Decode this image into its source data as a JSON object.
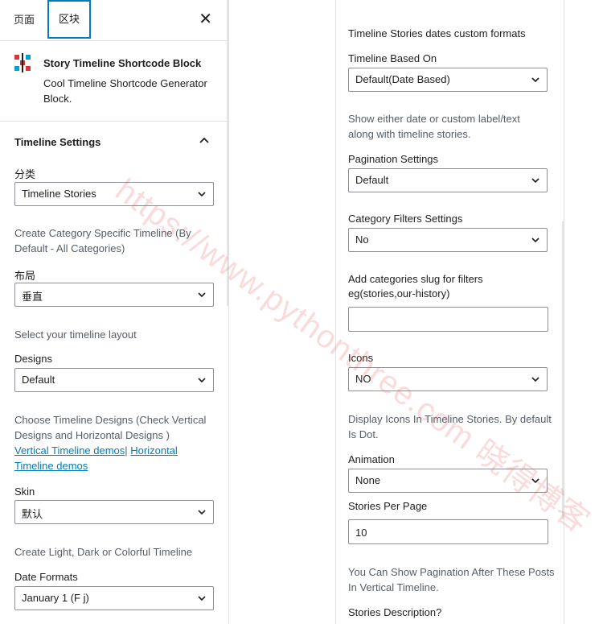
{
  "tabs": {
    "page": "页面",
    "block": "区块"
  },
  "block_card": {
    "title": "Story Timeline Shortcode Block",
    "description": "Cool Timeline Shortcode Generator Block."
  },
  "panel_title": "Timeline Settings",
  "left": {
    "category_label": "分类",
    "category_value": "Timeline Stories",
    "category_help": "Create Category Specific Timeline (By Default - All Categories)",
    "layout_label": "布局",
    "layout_value": "垂直",
    "layout_help": "Select your timeline layout",
    "designs_label": "Designs",
    "designs_value": "Default",
    "designs_help": "Choose Timeline Designs (Check Vertical Designs and Horizontal Designs )",
    "vertical_demo_link": "Vertical Timeline demos",
    "separator": "|",
    "horizontal_demo_link": "Horizontal Timeline demos",
    "skin_label": "Skin",
    "skin_value": "默认",
    "skin_help": "Create Light, Dark or Colorful Timeline",
    "date_formats_label": "Date Formats",
    "date_formats_value": "January 1 (F j)"
  },
  "right": {
    "dates_help": "Timeline Stories dates custom formats",
    "based_on_label": "Timeline Based On",
    "based_on_value": "Default(Date Based)",
    "based_on_help": "Show either date or custom label/text along with timeline stories.",
    "pagination_label": "Pagination Settings",
    "pagination_value": "Default",
    "category_filters_label": "Category Filters Settings",
    "category_filters_value": "No",
    "slug_label": "Add categories slug for filters eg(stories,our-history)",
    "slug_value": "",
    "icons_label": "Icons",
    "icons_value": "NO",
    "icons_help": "Display Icons In Timeline Stories. By default Is Dot.",
    "animation_label": "Animation",
    "animation_value": "None",
    "stories_per_page_label": "Stories Per Page",
    "stories_per_page_value": "10",
    "stories_per_page_help": "You Can Show Pagination After These Posts In Vertical Timeline.",
    "stories_description_label": "Stories Description?"
  },
  "watermark": "https://www.pythonthree.com 晓得博客",
  "colors": {
    "accent": "#007cba",
    "help_text": "#555d66",
    "border": "#8c8f94"
  },
  "icons": {
    "block_icon": "timeline-block-icon",
    "close": "close-icon",
    "collapse": "chevron-up-icon",
    "select_arrow": "chevron-down-icon"
  }
}
